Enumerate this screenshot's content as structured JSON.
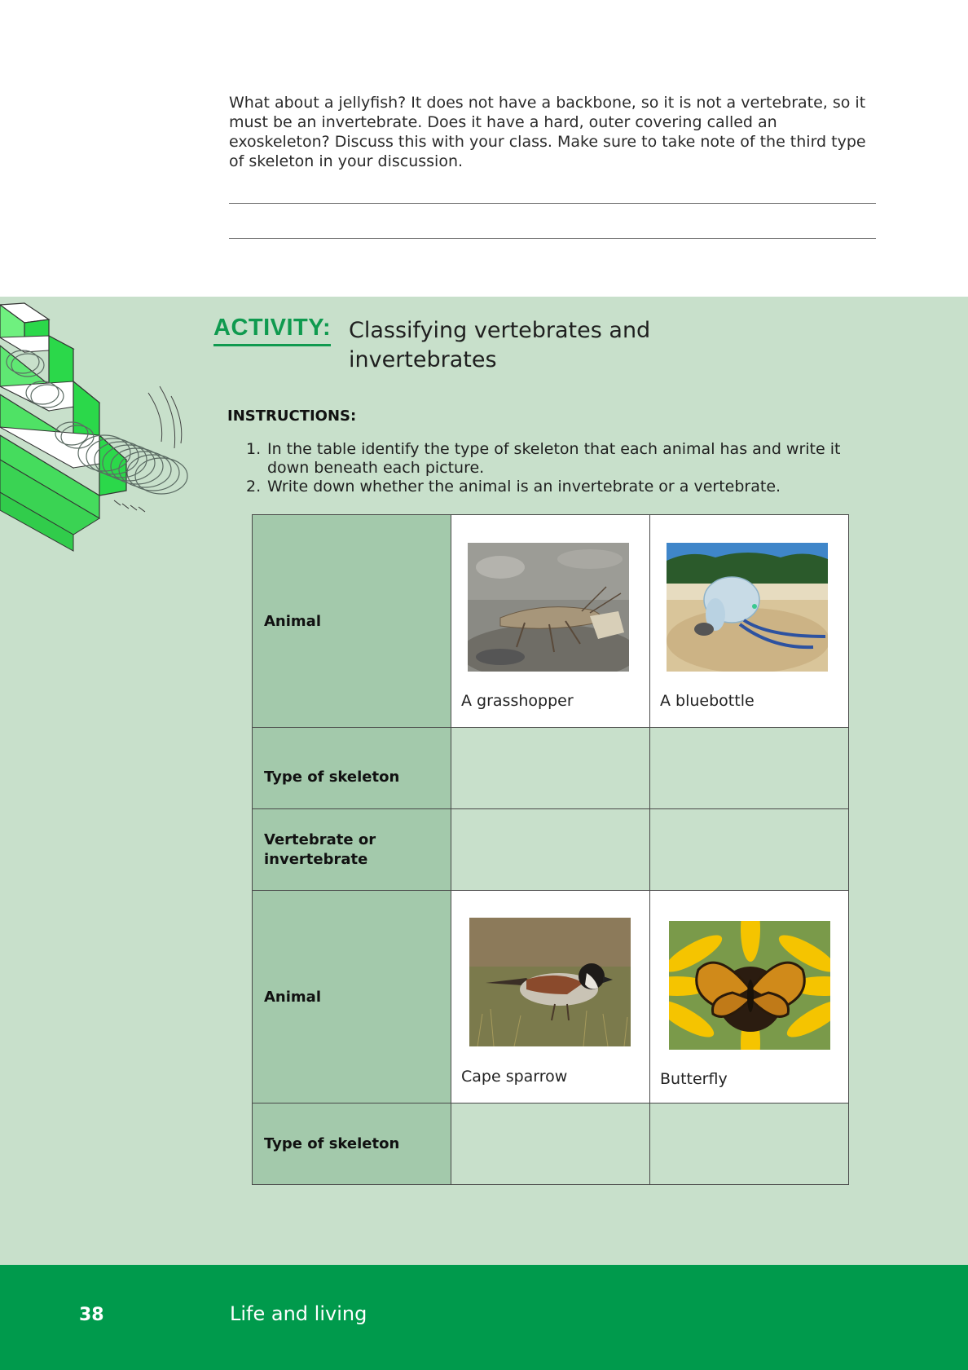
{
  "intro": {
    "text": "What about a jellyfish? It does not have a backbone, so it is not a vertebrate, so it must be an invertebrate. Does it have a hard, outer covering called an exoskeleton? Discuss this with your class. Make sure to take note of the third type of skeleton in your discussion."
  },
  "activity": {
    "label": "ACTIVITY:",
    "title": "Classifying vertebrates and invertebrates",
    "instructions_heading": "INSTRUCTIONS:",
    "instructions": [
      {
        "num": "1.",
        "text": "In the table identify the type of skeleton that each animal has and write it down beneath each picture."
      },
      {
        "num": "2.",
        "text": "Write down whether the animal is an invertebrate or a vertebrate."
      }
    ]
  },
  "table": {
    "rows": [
      {
        "header": "Animal",
        "kind": "animals",
        "cells": [
          {
            "caption": "A grasshopper",
            "image": "grasshopper-photo"
          },
          {
            "caption": "A bluebottle",
            "image": "bluebottle-photo"
          }
        ]
      },
      {
        "header": "Type of skeleton",
        "kind": "blank"
      },
      {
        "header": "Vertebrate or invertebrate",
        "kind": "blank"
      },
      {
        "header": "Animal",
        "kind": "animals",
        "cells": [
          {
            "caption": "Cape sparrow",
            "image": "cape-sparrow-photo"
          },
          {
            "caption": "Butterfly",
            "image": "butterfly-photo"
          }
        ]
      },
      {
        "header": "Type of skeleton",
        "kind": "blank"
      }
    ]
  },
  "footer": {
    "page_number": "38",
    "section": "Life and living"
  },
  "colors": {
    "brand_green": "#009a4c",
    "activity_green": "#0f9a4f",
    "band_background": "#c8e0cb",
    "header_cell": "#a3c9ab"
  }
}
